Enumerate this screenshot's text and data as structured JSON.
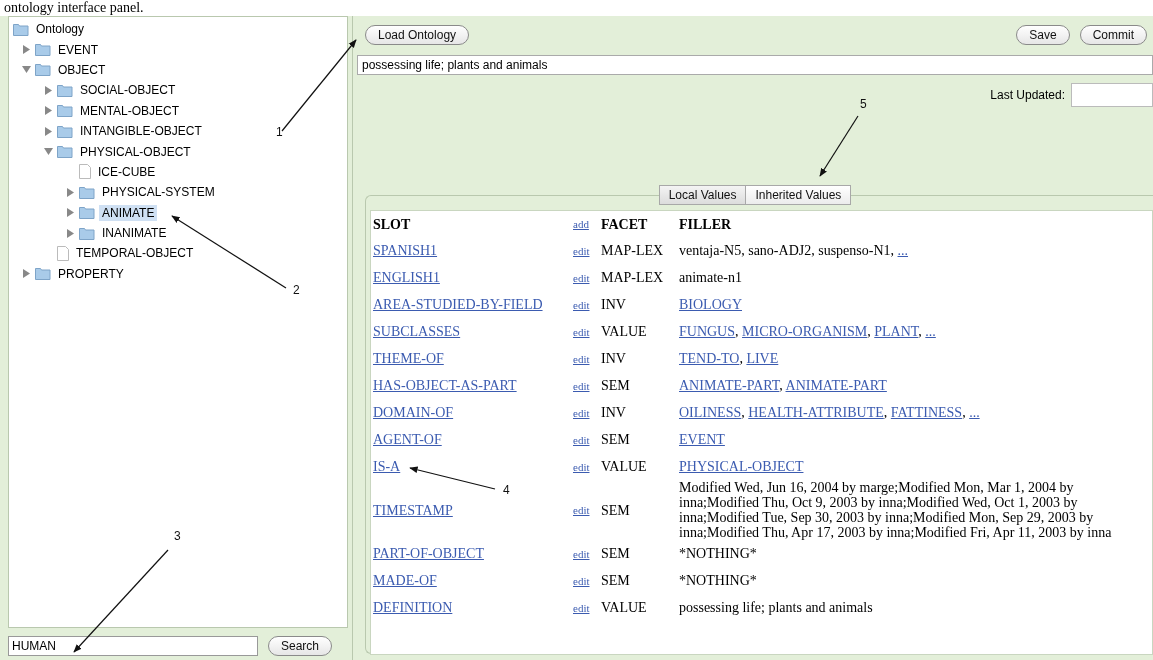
{
  "caption": "ontology interface panel.",
  "tree": [
    {
      "label": "Ontology",
      "kind": "root",
      "selected": false,
      "children": [
        {
          "label": "EVENT",
          "kind": "folder",
          "expanded": false,
          "selected": false
        },
        {
          "label": "OBJECT",
          "kind": "folder",
          "expanded": true,
          "selected": false,
          "children": [
            {
              "label": "SOCIAL-OBJECT",
              "kind": "folder",
              "expanded": false,
              "selected": false
            },
            {
              "label": "MENTAL-OBJECT",
              "kind": "folder",
              "expanded": false,
              "selected": false
            },
            {
              "label": "INTANGIBLE-OBJECT",
              "kind": "folder",
              "expanded": false,
              "selected": false
            },
            {
              "label": "PHYSICAL-OBJECT",
              "kind": "folder",
              "expanded": true,
              "selected": false,
              "children": [
                {
                  "label": "ICE-CUBE",
                  "kind": "file",
                  "selected": false
                },
                {
                  "label": "PHYSICAL-SYSTEM",
                  "kind": "folder",
                  "expanded": false,
                  "selected": false
                },
                {
                  "label": "ANIMATE",
                  "kind": "folder",
                  "expanded": false,
                  "selected": true
                },
                {
                  "label": "INANIMATE",
                  "kind": "folder",
                  "expanded": false,
                  "selected": false
                }
              ]
            },
            {
              "label": "TEMPORAL-OBJECT",
              "kind": "file",
              "selected": false
            }
          ]
        },
        {
          "label": "PROPERTY",
          "kind": "folder",
          "expanded": false,
          "selected": false
        }
      ]
    }
  ],
  "search": {
    "value": "HUMAN",
    "button": "Search"
  },
  "toolbar": {
    "load_button": "Load Ontology",
    "save_button": "Save",
    "commit_button": "Commit"
  },
  "definition_field": {
    "value": "possessing life; plants and animals"
  },
  "last_updated": {
    "label": "Last Updated:"
  },
  "tabs": [
    {
      "label": "Local Values",
      "selected": true
    },
    {
      "label": "Inherited Values",
      "selected": false
    }
  ],
  "table": {
    "columns": {
      "slot": "SLOT",
      "add": "add",
      "facet": "FACET",
      "filler": "FILLER"
    },
    "rows": [
      {
        "slot": "SPANISH1",
        "action": "edit",
        "facet": "MAP-LEX",
        "filler": [
          {
            "text": "ventaja-N5, sano-ADJ2, suspenso-N1, ",
            "link": false
          },
          {
            "text": "...",
            "link": true
          }
        ]
      },
      {
        "slot": "ENGLISH1",
        "action": "edit",
        "facet": "MAP-LEX",
        "filler": [
          {
            "text": "animate-n1",
            "link": false
          }
        ]
      },
      {
        "slot": "AREA-STUDIED-BY-FIELD",
        "action": "edit",
        "facet": "INV",
        "filler": [
          {
            "text": "BIOLOGY",
            "link": true
          }
        ]
      },
      {
        "slot": "SUBCLASSES",
        "action": "edit",
        "facet": "VALUE",
        "filler": [
          {
            "text": "FUNGUS",
            "link": true
          },
          {
            "text": ", ",
            "link": false
          },
          {
            "text": "MICRO-ORGANISM",
            "link": true
          },
          {
            "text": ", ",
            "link": false
          },
          {
            "text": "PLANT",
            "link": true
          },
          {
            "text": ", ",
            "link": false
          },
          {
            "text": "...",
            "link": true
          }
        ]
      },
      {
        "slot": "THEME-OF",
        "action": "edit",
        "facet": "INV",
        "filler": [
          {
            "text": "TEND-TO",
            "link": true
          },
          {
            "text": ", ",
            "link": false
          },
          {
            "text": "LIVE",
            "link": true
          }
        ]
      },
      {
        "slot": "HAS-OBJECT-AS-PART",
        "action": "edit",
        "facet": "SEM",
        "filler": [
          {
            "text": "ANIMATE-PART",
            "link": true
          },
          {
            "text": ", ",
            "link": false
          },
          {
            "text": "ANIMATE-PART",
            "link": true
          }
        ]
      },
      {
        "slot": "DOMAIN-OF",
        "action": "edit",
        "facet": "INV",
        "filler": [
          {
            "text": "OILINESS",
            "link": true
          },
          {
            "text": ", ",
            "link": false
          },
          {
            "text": "HEALTH-ATTRIBUTE",
            "link": true
          },
          {
            "text": ", ",
            "link": false
          },
          {
            "text": "FATTINESS",
            "link": true
          },
          {
            "text": ", ",
            "link": false
          },
          {
            "text": "...",
            "link": true
          }
        ]
      },
      {
        "slot": "AGENT-OF",
        "action": "edit",
        "facet": "SEM",
        "filler": [
          {
            "text": "EVENT",
            "link": true
          }
        ]
      },
      {
        "slot": "IS-A",
        "action": "edit",
        "facet": "VALUE",
        "filler": [
          {
            "text": "PHYSICAL-OBJECT",
            "link": true
          }
        ]
      },
      {
        "slot": "TIMESTAMP",
        "action": "edit",
        "facet": "SEM",
        "filler": [
          {
            "text": "Modified Wed, Jun 16, 2004 by marge;Modified Mon, Mar 1, 2004 by inna;Modified Thu, Oct 9, 2003 by inna;Modified Wed, Oct 1, 2003 by inna;Modified Tue, Sep 30, 2003 by inna;Modified Mon, Sep 29, 2003 by inna;Modified Thu, Apr 17, 2003 by inna;Modified Fri, Apr 11, 2003 by inna",
            "link": false
          }
        ]
      },
      {
        "slot": "PART-OF-OBJECT",
        "action": "edit",
        "facet": "SEM",
        "filler": [
          {
            "text": "*NOTHING*",
            "link": false
          }
        ]
      },
      {
        "slot": "MADE-OF",
        "action": "edit",
        "facet": "SEM",
        "filler": [
          {
            "text": "*NOTHING*",
            "link": false
          }
        ]
      },
      {
        "slot": "DEFINITION",
        "action": "edit",
        "facet": "VALUE",
        "filler": [
          {
            "text": "possessing life; plants and animals",
            "link": false
          }
        ]
      }
    ]
  },
  "annotations": [
    {
      "label": "1"
    },
    {
      "label": "2"
    },
    {
      "label": "3"
    },
    {
      "label": "4"
    },
    {
      "label": "5"
    }
  ]
}
